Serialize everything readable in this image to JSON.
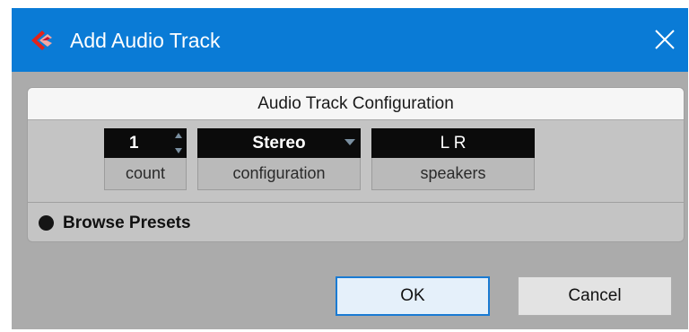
{
  "window": {
    "title": "Add Audio Track",
    "title_bar_color": "#0a7bd6",
    "app_icon": "cubase-logo-icon",
    "close_icon": "close-icon"
  },
  "config": {
    "header": "Audio Track Configuration",
    "count": {
      "value": "1",
      "label": "count"
    },
    "configuration": {
      "value": "Stereo",
      "label": "configuration"
    },
    "speakers": {
      "value": "L R",
      "label": "speakers"
    }
  },
  "browse_presets": {
    "label": "Browse Presets"
  },
  "buttons": {
    "ok": "OK",
    "cancel": "Cancel"
  }
}
